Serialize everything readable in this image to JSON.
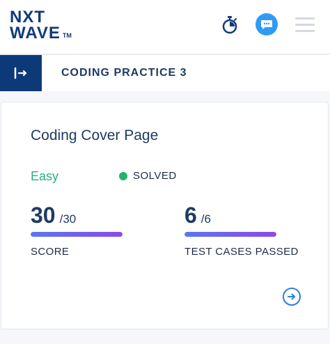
{
  "header": {
    "logo": {
      "line1": "NXT",
      "line2": "WAVE",
      "trademark": "TM"
    },
    "icons": {
      "timer": "timer-icon",
      "chat": "chat-bubble-icon",
      "menu": "hamburger-menu-icon"
    },
    "accent_color": "#2f9cf4",
    "brand_color": "#0f3a7a"
  },
  "practice": {
    "title": "CODING PRACTICE 3",
    "collapse_icon": "sidebar-toggle-icon"
  },
  "card": {
    "title": "Coding Cover Page",
    "difficulty": "Easy",
    "status": "SOLVED",
    "status_color": "#23b26d",
    "score": {
      "value": "30",
      "total": "/30",
      "label": "SCORE",
      "fraction": 1.0
    },
    "tests": {
      "value": "6",
      "total": "/6",
      "label": "TEST CASES PASSED",
      "fraction": 1.0
    },
    "next_icon": "arrow-right-circle-icon"
  }
}
